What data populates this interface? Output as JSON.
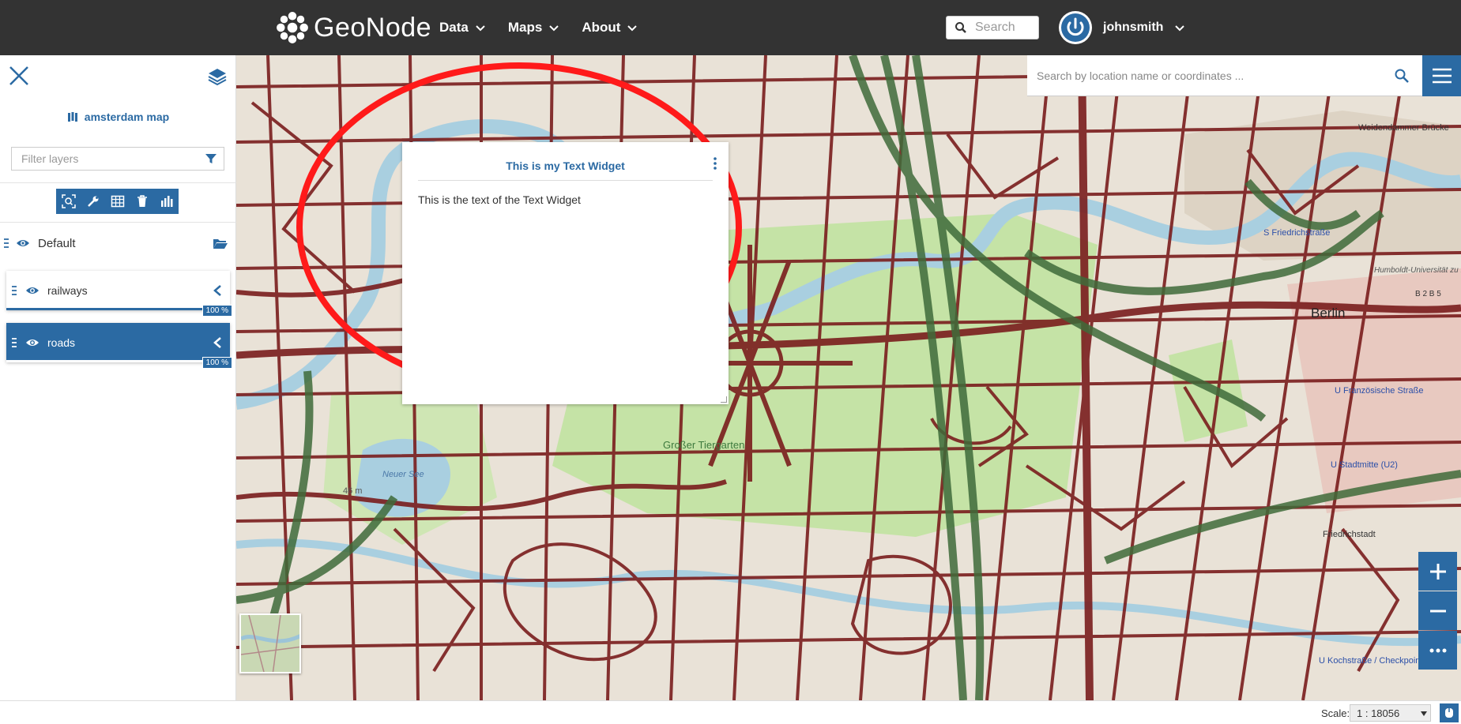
{
  "navbar": {
    "brand": "GeoNode",
    "menu": [
      {
        "label": "Data"
      },
      {
        "label": "Maps"
      },
      {
        "label": "About"
      }
    ],
    "search_placeholder": "Search",
    "user": "johnsmith"
  },
  "sidebar": {
    "map_title": "amsterdam map",
    "filter_placeholder": "Filter layers",
    "toolbar": [
      "zoom-to-layer",
      "settings",
      "attribute-table",
      "delete",
      "widgets"
    ],
    "group": {
      "label": "Default"
    },
    "layers": [
      {
        "name": "railways",
        "opacity": "100 %",
        "selected": false
      },
      {
        "name": "roads",
        "opacity": "100 %",
        "selected": true
      }
    ]
  },
  "map": {
    "search_placeholder": "Search by location name or coordinates ...",
    "widget": {
      "title": "This is my Text Widget",
      "body": "This is the text of the Text Widget"
    },
    "labels": {
      "city": "Berlin",
      "lake": "Neuer See",
      "park": "Großer Tiergarten",
      "elevation": "46 m",
      "station1": "S Friedrichstraße",
      "station2": "U Französische Straße",
      "station3": "U Stadtmitte (U2)",
      "station4": "U Kochstraße / Checkpoint Charlie",
      "district": "Friedrichstadt",
      "bridge": "Weidendammer Brücke",
      "road_b": "B 2 B 5",
      "uni": "Humboldt-Universität zu Berlin"
    },
    "annotation_color": "#ff1a1a",
    "roads_color": "#7a1d1d",
    "railways_color": "#3f6b3a"
  },
  "footer": {
    "scale_label": "Scale:",
    "scale_value": "1 : 18056"
  },
  "colors": {
    "primary": "#2b6aa3",
    "navbar": "#333333"
  }
}
